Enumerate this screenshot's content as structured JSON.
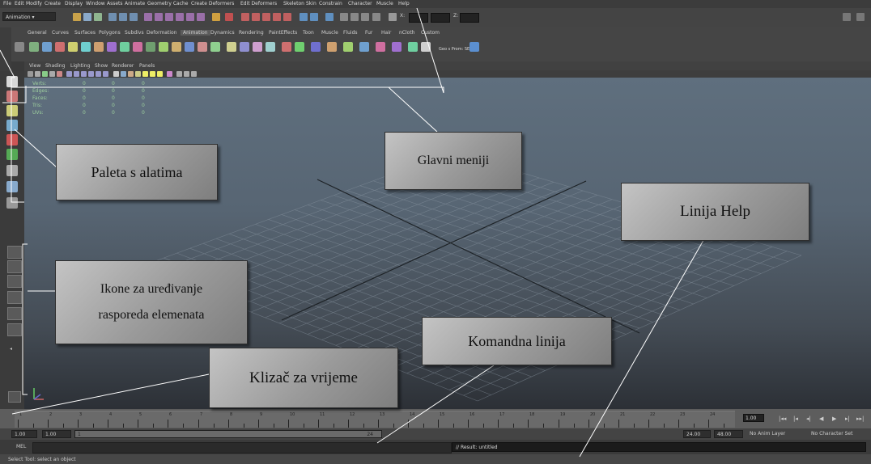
{
  "menu": [
    "File",
    "Edit",
    "Modify",
    "Create",
    "Display",
    "Window",
    "Assets",
    "Animate",
    "Geometry Cache",
    "Create Deformers",
    "Edit Deformers",
    "Skeleton",
    "Skin",
    "Constrain",
    "Character",
    "Muscle",
    "Help"
  ],
  "status": {
    "mode": "Animation",
    "x_label": "X:",
    "z_label": "Z:"
  },
  "shelf_tabs": [
    "General",
    "Curves",
    "Surfaces",
    "Polygons",
    "Subdivs",
    "Deformation",
    "Animation",
    "Dynamics",
    "Rendering",
    "PaintEffects",
    "Toon",
    "Muscle",
    "Fluids",
    "Fur",
    "Hair",
    "nCloth",
    "Custom"
  ],
  "shelf_active": "Animation",
  "shelf_text": "Geo s Prom: SE",
  "panel_menu": [
    "View",
    "Shading",
    "Lighting",
    "Show",
    "Renderer",
    "Panels"
  ],
  "hud": {
    "labels": [
      "Verts:",
      "Edges:",
      "Faces:",
      "Tris:",
      "UVs:"
    ],
    "value": "0"
  },
  "timeline": {
    "ticks": [
      "1",
      "2",
      "3",
      "4",
      "5",
      "6",
      "7",
      "8",
      "9",
      "10",
      "11",
      "12",
      "13",
      "14",
      "15",
      "16",
      "17",
      "18",
      "19",
      "20",
      "21",
      "22",
      "23",
      "24"
    ],
    "current": "1.00"
  },
  "range": {
    "start": "1.00",
    "start2": "1.00",
    "slider_start": "1",
    "slider_end": "24",
    "end": "24.00",
    "end2": "48.00",
    "anim_layer": "No Anim Layer",
    "char_set": "No Character Set"
  },
  "command": {
    "label": "MEL",
    "result": "// Result: untitled"
  },
  "help_text": "Select Tool: select an object",
  "callouts": {
    "paleta": "Paleta s alatima",
    "glavni": "Glavni meniji",
    "help": "Linija Help",
    "ikone_1": "Ikone za uređivanje",
    "ikone_2": "rasporeda elemenata",
    "komandna": "Komandna linija",
    "klizac": "Klizač za vrijeme"
  }
}
